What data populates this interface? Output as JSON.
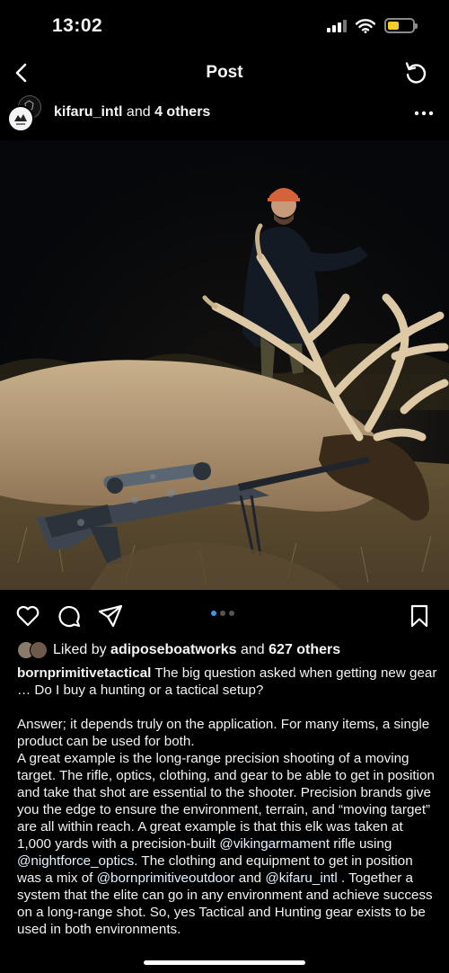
{
  "status_bar": {
    "time": "13:02",
    "battery_color": "#f5cc2a"
  },
  "nav": {
    "title": "Post",
    "back_icon": "chevron-left-icon",
    "refresh_icon": "refresh-icon"
  },
  "post": {
    "author": "kifaru_intl",
    "author_suffix_and": "and",
    "author_others": "4 others",
    "more_icon": "more-horizontal-icon"
  },
  "actions": {
    "like_icon": "heart-icon",
    "comment_icon": "comment-icon",
    "share_icon": "send-icon",
    "save_icon": "bookmark-icon",
    "carousel_total": 3,
    "carousel_active": 1,
    "accent": "#3897f0"
  },
  "likes": {
    "prefix": "Liked by",
    "liker": "adiposeboatworks",
    "and": "and",
    "others": "627 others"
  },
  "caption": {
    "author": "bornprimitivetactical",
    "p1": "The big question asked when getting new gear … Do I buy a hunting or a tactical setup?",
    "p2": "Answer; it depends truly on the application. For many items, a single product can be used for both.",
    "p3a": "A great example is the long-range precision shooting of a moving target. The rifle, optics, clothing, and gear to be able to get in position and take that shot are essential to the shooter. Precision brands give you the edge to ensure the environment, terrain, and “moving target” are all within reach. A great example is that this elk was taken at 1,000 yards with a precision-built",
    "m1": "@vikingarmament",
    "p3b": "rifle using",
    "m2": "@nightforce_optics",
    "p3c": ". The clothing and equipment to get in position was a mix of",
    "m3": "@bornprimitiveoutdoor",
    "p3d": "and",
    "m4": "@kifaru_intl",
    "p3e": ". Together a system that the elite can go in any environment and achieve success on a long-range shot. So, yes Tactical and Hunting gear exists to be used in both environments."
  }
}
